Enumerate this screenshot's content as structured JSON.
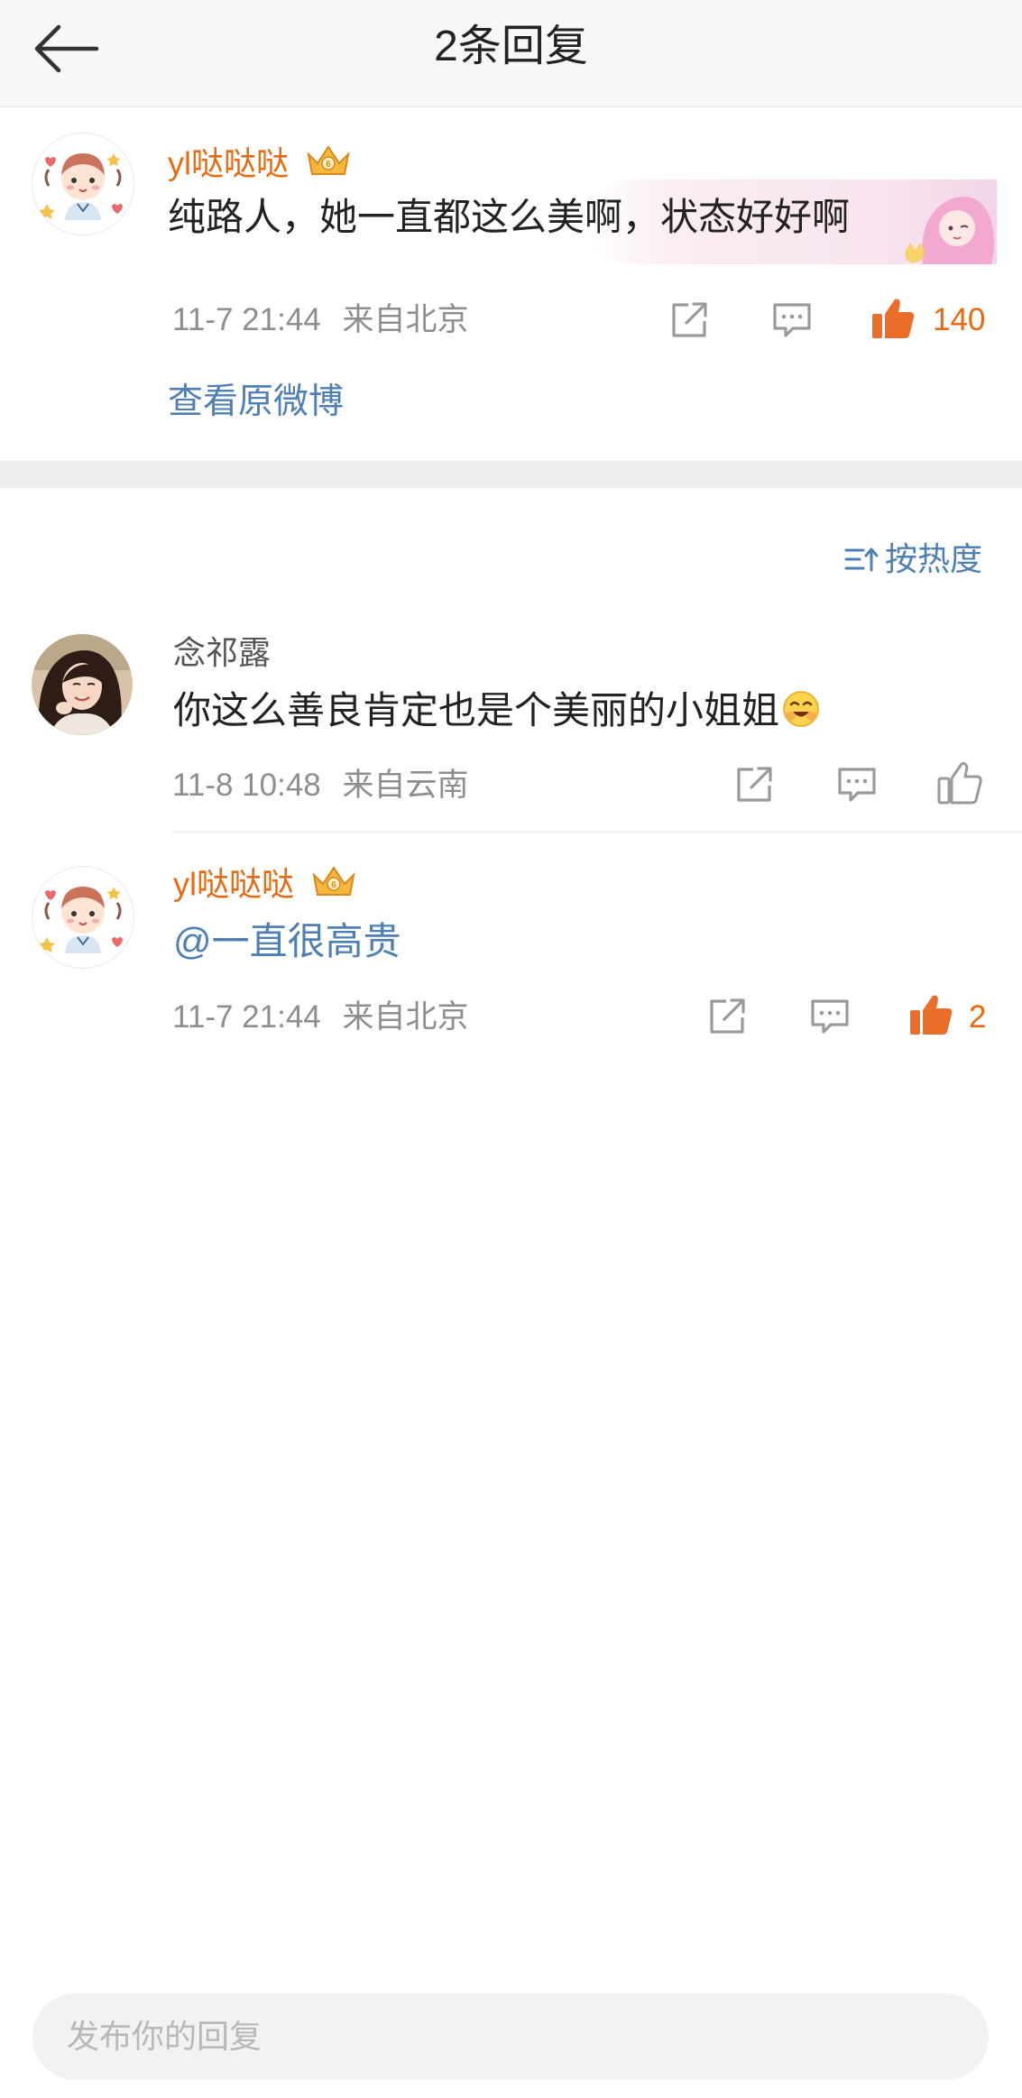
{
  "header": {
    "title": "2条回复",
    "back_icon": "back-arrow-icon"
  },
  "root_comment": {
    "username": "yl哒哒哒",
    "text": "纯路人，她一直都这么美啊，状态好好啊",
    "date": "11-7 21:44",
    "location": "来自北京",
    "like_count": "140",
    "liked": true,
    "view_original": "查看原微博"
  },
  "sort": {
    "label": "按热度"
  },
  "replies": [
    {
      "username": "念祁露",
      "vip": false,
      "text": "你这么善良肯定也是个美丽的小姐姐",
      "emoji": "😊",
      "date": "11-8 10:48",
      "location": "来自云南",
      "like_count": "",
      "liked": false
    },
    {
      "username": "yl哒哒哒",
      "vip": true,
      "text": "@一直很高贵",
      "date": "11-7 21:44",
      "location": "来自北京",
      "like_count": "2",
      "liked": true
    }
  ],
  "reply_bar": {
    "placeholder": "发布你的回复"
  },
  "colors": {
    "accent_orange": "#e86a10",
    "link_blue": "#4f7fb3",
    "meta_gray": "#8e8e8e"
  }
}
